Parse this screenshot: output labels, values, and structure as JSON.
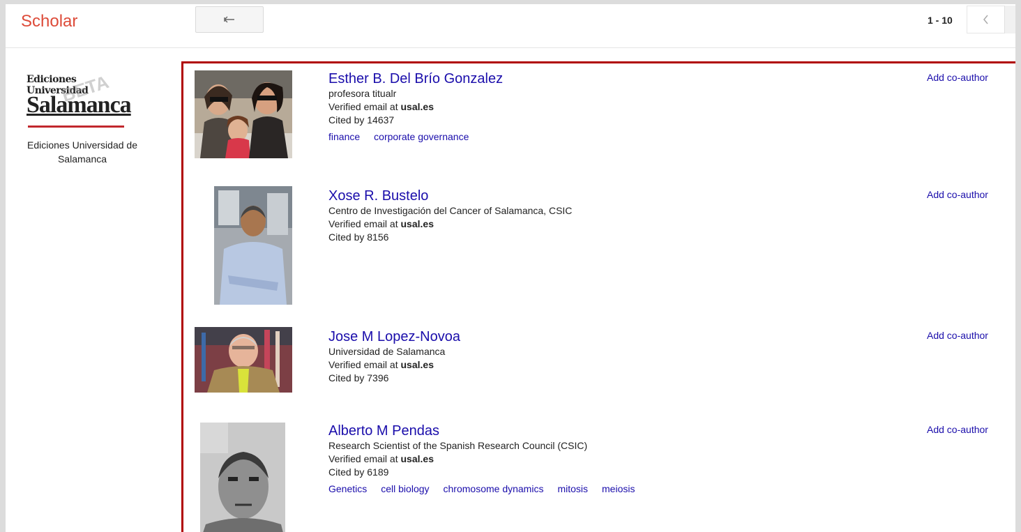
{
  "header": {
    "brand": "Scholar",
    "back_icon": "back-arrow-icon",
    "pager_range": "1 - 10",
    "prev_icon": "chevron-left-icon"
  },
  "sidebar": {
    "logo_text_top": "Ediciones Universidad",
    "logo_text_main": "Salamanca",
    "logo_watermark": "BETA",
    "institution_name": "Ediciones Universidad de Salamanca"
  },
  "results": [
    {
      "name": "Esther B. Del Brío Gonzalez",
      "affiliation": "profesora titualr",
      "email_prefix": "Verified email at ",
      "email_domain": "usal.es",
      "cited": "Cited by 14637",
      "tags": [
        "finance",
        "corporate governance"
      ],
      "action": "Add co-author"
    },
    {
      "name": "Xose R. Bustelo",
      "affiliation": "Centro de Investigación del Cancer of Salamanca, CSIC",
      "email_prefix": "Verified email at ",
      "email_domain": "usal.es",
      "cited": "Cited by 8156",
      "tags": [],
      "action": "Add co-author"
    },
    {
      "name": "Jose M Lopez-Novoa",
      "affiliation": "Universidad de Salamanca",
      "email_prefix": "Verified email at ",
      "email_domain": "usal.es",
      "cited": "Cited by 7396",
      "tags": [],
      "action": "Add co-author"
    },
    {
      "name": "Alberto M Pendas",
      "affiliation": "Research Scientist of the Spanish Research Council (CSIC)",
      "email_prefix": "Verified email at ",
      "email_domain": "usal.es",
      "cited": "Cited by 6189",
      "tags": [
        "Genetics",
        "cell biology",
        "chromosome dynamics",
        "mitosis",
        "meiosis"
      ],
      "action": "Add co-author"
    }
  ]
}
